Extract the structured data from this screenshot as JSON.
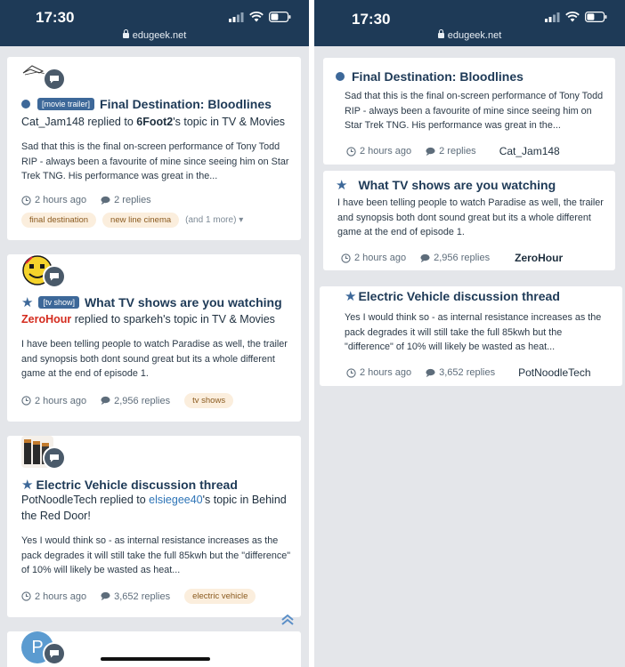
{
  "status": {
    "time": "17:30",
    "url": "edugeek.net"
  },
  "left_feed": [
    {
      "prefix": "[movie trailer]",
      "title": "Final Destination: Bloodlines",
      "author": "Cat_Jam148",
      "replied_to": " replied to ",
      "target": "6Foot2",
      "topic_suffix": "'s topic in TV & Movies",
      "excerpt": "Sad that this is the final on-screen performance of Tony Todd RIP - always been a favourite of mine since seeing him on Star Trek TNG. His performance was great in the...",
      "time": "2 hours ago",
      "replies": "2 replies",
      "tags": [
        "final destination",
        "new line cinema"
      ],
      "more": "(and 1 more)"
    },
    {
      "prefix": "[tv show]",
      "title": "What TV shows are you watching",
      "author": "ZeroHour",
      "replied_to": " replied to sparkeh's topic in TV & Movies",
      "excerpt": "I have been telling people to watch Paradise as well, the trailer and synopsis both dont sound great but its a whole different game at the end of episode 1.",
      "time": "2 hours ago",
      "replies": "2,956 replies",
      "tags": [
        "tv shows"
      ]
    },
    {
      "title": "Electric Vehicle discussion thread",
      "author": "PotNoodleTech",
      "replied_to": " replied to ",
      "target": "elsiegee40",
      "topic_suffix": "'s topic in Behind the Red Door!",
      "excerpt": "Yes I would think so - as internal resistance increases as the pack degrades it will still take the full 85kwh but the \"difference\" of 10% will likely be wasted as heat...",
      "time": "2 hours ago",
      "replies": "3,652 replies",
      "tags": [
        "electric vehicle"
      ]
    },
    {
      "avatar_letter": "P"
    }
  ],
  "right_feed": [
    {
      "title": "Final Destination: Bloodlines",
      "excerpt": "Sad that this is the final on-screen performance of Tony Todd RIP - always been a favourite of mine since seeing him on Star Trek TNG. His performance was great in the...",
      "time": "2 hours ago",
      "replies": "2 replies",
      "author": "Cat_Jam148"
    },
    {
      "title": "What TV shows are you watching",
      "excerpt": "I have been telling people to watch Paradise as well, the trailer and synopsis both dont sound great but its a whole different game at the end of episode 1.",
      "time": "2 hours ago",
      "replies": "2,956 replies",
      "author": "ZeroHour"
    },
    {
      "title": "Electric Vehicle discussion thread",
      "excerpt": "Yes I would think so - as internal resistance increases as the pack degrades it will still take the full 85kwh but the \"difference\" of 10% will likely be wasted as heat...",
      "time": "2 hours ago",
      "replies": "3,652 replies",
      "author": "PotNoodleTech"
    }
  ],
  "colors": {
    "header": "#1e3a57",
    "accent": "#3d6899",
    "author_highlight": "#d42b1e",
    "link": "#2d74b7",
    "tag_bg": "#fbeedd"
  },
  "icons": [
    "signal-icon",
    "wifi-icon",
    "battery-icon",
    "lock-icon",
    "chat-bubble-icon",
    "clock-icon",
    "comment-icon",
    "star-icon",
    "chevron-down-icon",
    "scroll-top-icon"
  ]
}
